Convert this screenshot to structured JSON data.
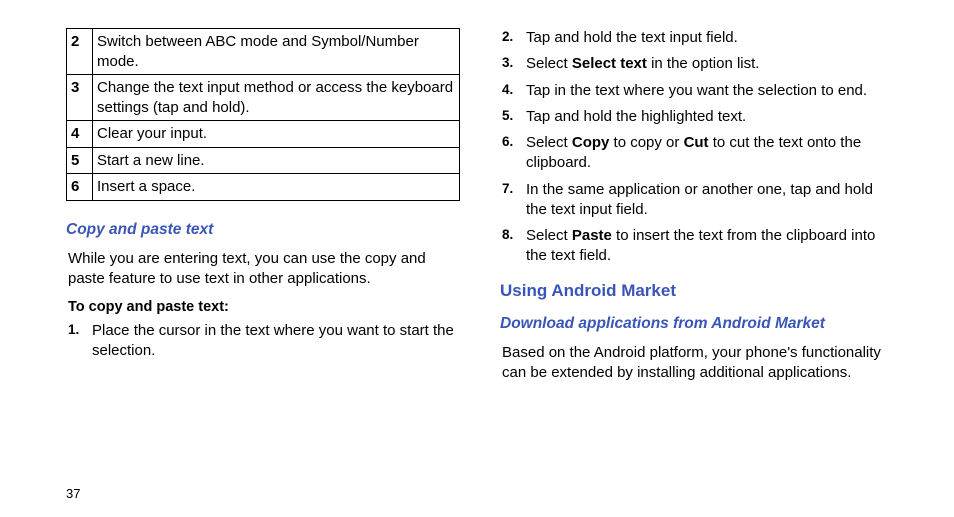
{
  "table": {
    "rows": [
      {
        "n": "2",
        "txt": "Switch between ABC mode and Symbol/Number mode."
      },
      {
        "n": "3",
        "txt": "Change the text input method or access the keyboard settings (tap and hold)."
      },
      {
        "n": "4",
        "txt": "Clear your input."
      },
      {
        "n": "5",
        "txt": "Start a new line."
      },
      {
        "n": "6",
        "txt": "Insert a space."
      }
    ]
  },
  "h3_copy": "Copy and paste text",
  "intro": "While you are entering text, you can use the copy and paste feature to use text in other applications.",
  "lead": "To copy and paste text:",
  "steps_left": [
    {
      "n": "1.",
      "txt": "Place the cursor in the text where you want to start the selection."
    }
  ],
  "steps_right": [
    {
      "n": "2.",
      "txt": "Tap and hold the text input field."
    },
    {
      "n": "3.",
      "pre": "Select ",
      "bold": "Select text",
      "post": " in the option list."
    },
    {
      "n": "4.",
      "txt": "Tap in the text where you want the selection to end."
    },
    {
      "n": "5.",
      "txt": "Tap and hold the highlighted text."
    },
    {
      "n": "6.",
      "pre": "Select ",
      "bold": "Copy",
      "mid": " to copy or ",
      "bold2": "Cut",
      "post": " to cut the text onto the clipboard."
    },
    {
      "n": "7.",
      "txt": "In the same application or another one, tap and hold the text input field."
    },
    {
      "n": "8.",
      "pre": "Select ",
      "bold": "Paste",
      "post": " to insert the text from the clipboard into the text field."
    }
  ],
  "h2_market": "Using Android Market",
  "h3_download": "Download applications from Android Market",
  "market_body": "Based on the Android platform, your phone's functionality can be extended by installing additional applications.",
  "page_number": "37"
}
